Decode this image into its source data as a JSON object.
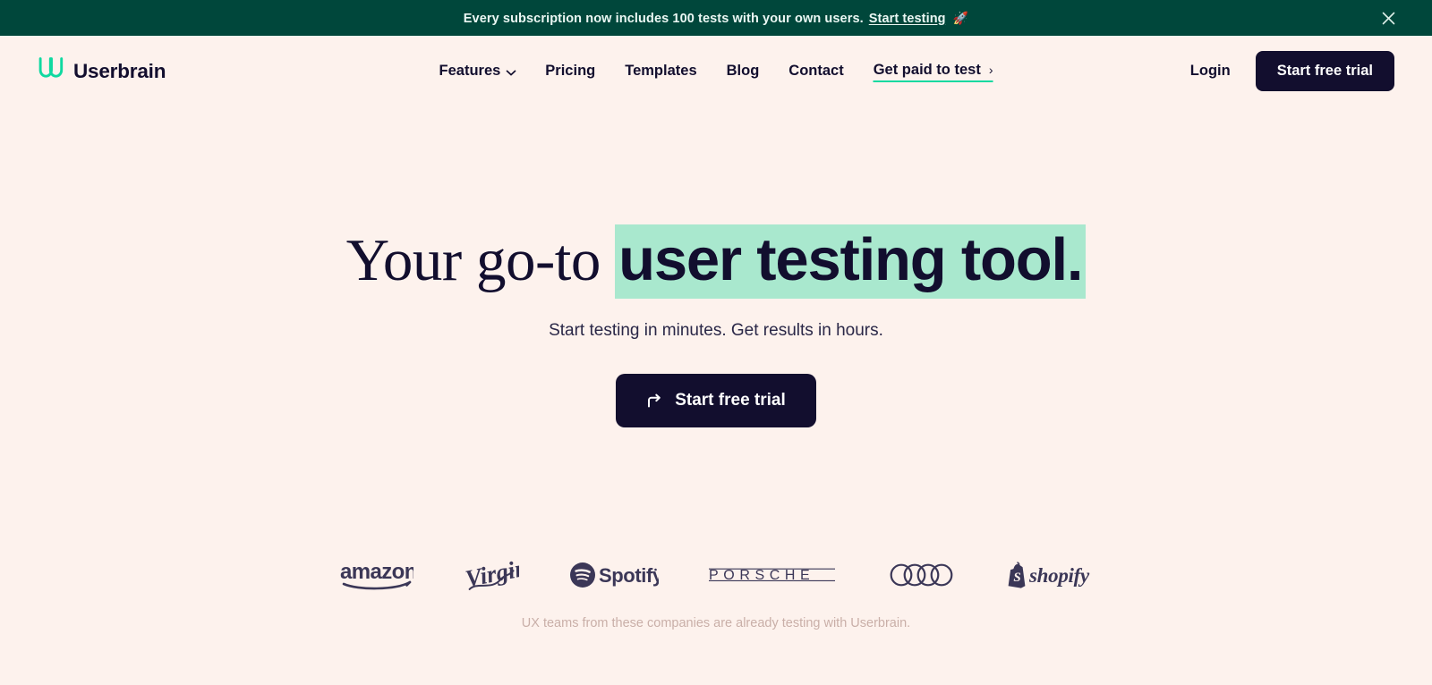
{
  "colors": {
    "page_bg": "#FDF2ED",
    "banner_bg": "#00473B",
    "ink": "#120E2E",
    "mint": "#0FD9A0",
    "highlight": "#A9E8CE",
    "caption": "#C9AFA8",
    "logo_ink": "#3B3757"
  },
  "banner": {
    "message": "Every subscription now includes 100 tests with your own users.",
    "link_label": "Start testing",
    "emoji": "🚀",
    "close_icon": "close-icon"
  },
  "header": {
    "brand": {
      "name": "Userbrain",
      "mark_icon": "userbrain-logo-icon"
    },
    "nav": [
      {
        "label": "Features",
        "has_dropdown": true,
        "caret_icon": "chevron-down-icon",
        "highlighted": false
      },
      {
        "label": "Pricing",
        "has_dropdown": false,
        "highlighted": false
      },
      {
        "label": "Templates",
        "has_dropdown": false,
        "highlighted": false
      },
      {
        "label": "Blog",
        "has_dropdown": false,
        "highlighted": false
      },
      {
        "label": "Contact",
        "has_dropdown": false,
        "highlighted": false
      },
      {
        "label": "Get paid to test",
        "has_dropdown": false,
        "highlighted": true,
        "chevron": "›"
      }
    ],
    "login_label": "Login",
    "cta_label": "Start free trial"
  },
  "hero": {
    "title_plain": "Your go-to ",
    "title_highlight": "user testing tool.",
    "subtitle": "Start testing in minutes. Get results in hours.",
    "cta_label": "Start free trial",
    "cta_icon": "arrow-turn-right-icon"
  },
  "social_proof": {
    "logos": [
      {
        "name": "amazon",
        "icon": "amazon-logo-icon"
      },
      {
        "name": "Virgin",
        "icon": "virgin-logo-icon"
      },
      {
        "name": "Spotify",
        "icon": "spotify-logo-icon"
      },
      {
        "name": "PORSCHE",
        "icon": "porsche-logo-icon"
      },
      {
        "name": "Audi",
        "icon": "audi-logo-icon"
      },
      {
        "name": "shopify",
        "icon": "shopify-logo-icon"
      }
    ],
    "caption": "UX teams from these companies are already testing with Userbrain."
  }
}
